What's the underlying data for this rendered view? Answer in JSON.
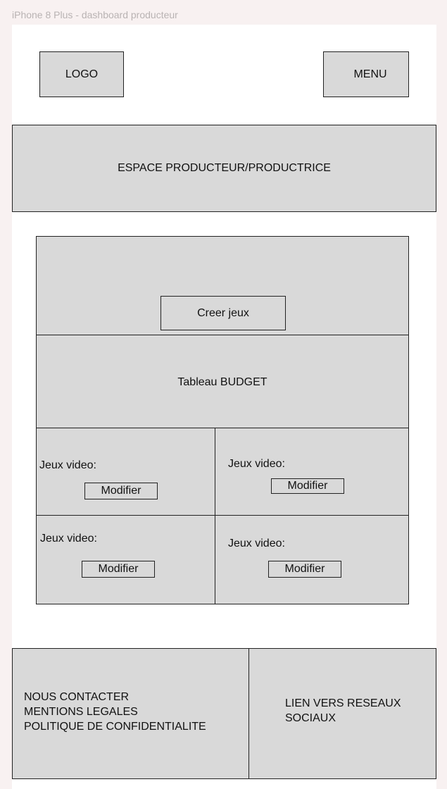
{
  "frame_label": "iPhone 8 Plus - dashboard producteur",
  "header": {
    "logo": "LOGO",
    "menu": "MENU"
  },
  "banner": {
    "title": "ESPACE PRODUCTEUR/PRODUCTRICE"
  },
  "dashboard": {
    "create_button": "Creer jeux",
    "budget_title": "Tableau BUDGET",
    "games": [
      {
        "label": "Jeux video:",
        "button": "Modifier"
      },
      {
        "label": "Jeux video:",
        "button": "Modifier"
      },
      {
        "label": "Jeux video:",
        "button": "Modifier"
      },
      {
        "label": "Jeux video:",
        "button": "Modifier"
      }
    ]
  },
  "footer": {
    "links": [
      "NOUS CONTACTER",
      "MENTIONS LEGALES",
      "POLITIQUE DE CONFIDENTIALITE"
    ],
    "social": [
      "LIEN VERS RESEAUX",
      "SOCIAUX"
    ]
  }
}
